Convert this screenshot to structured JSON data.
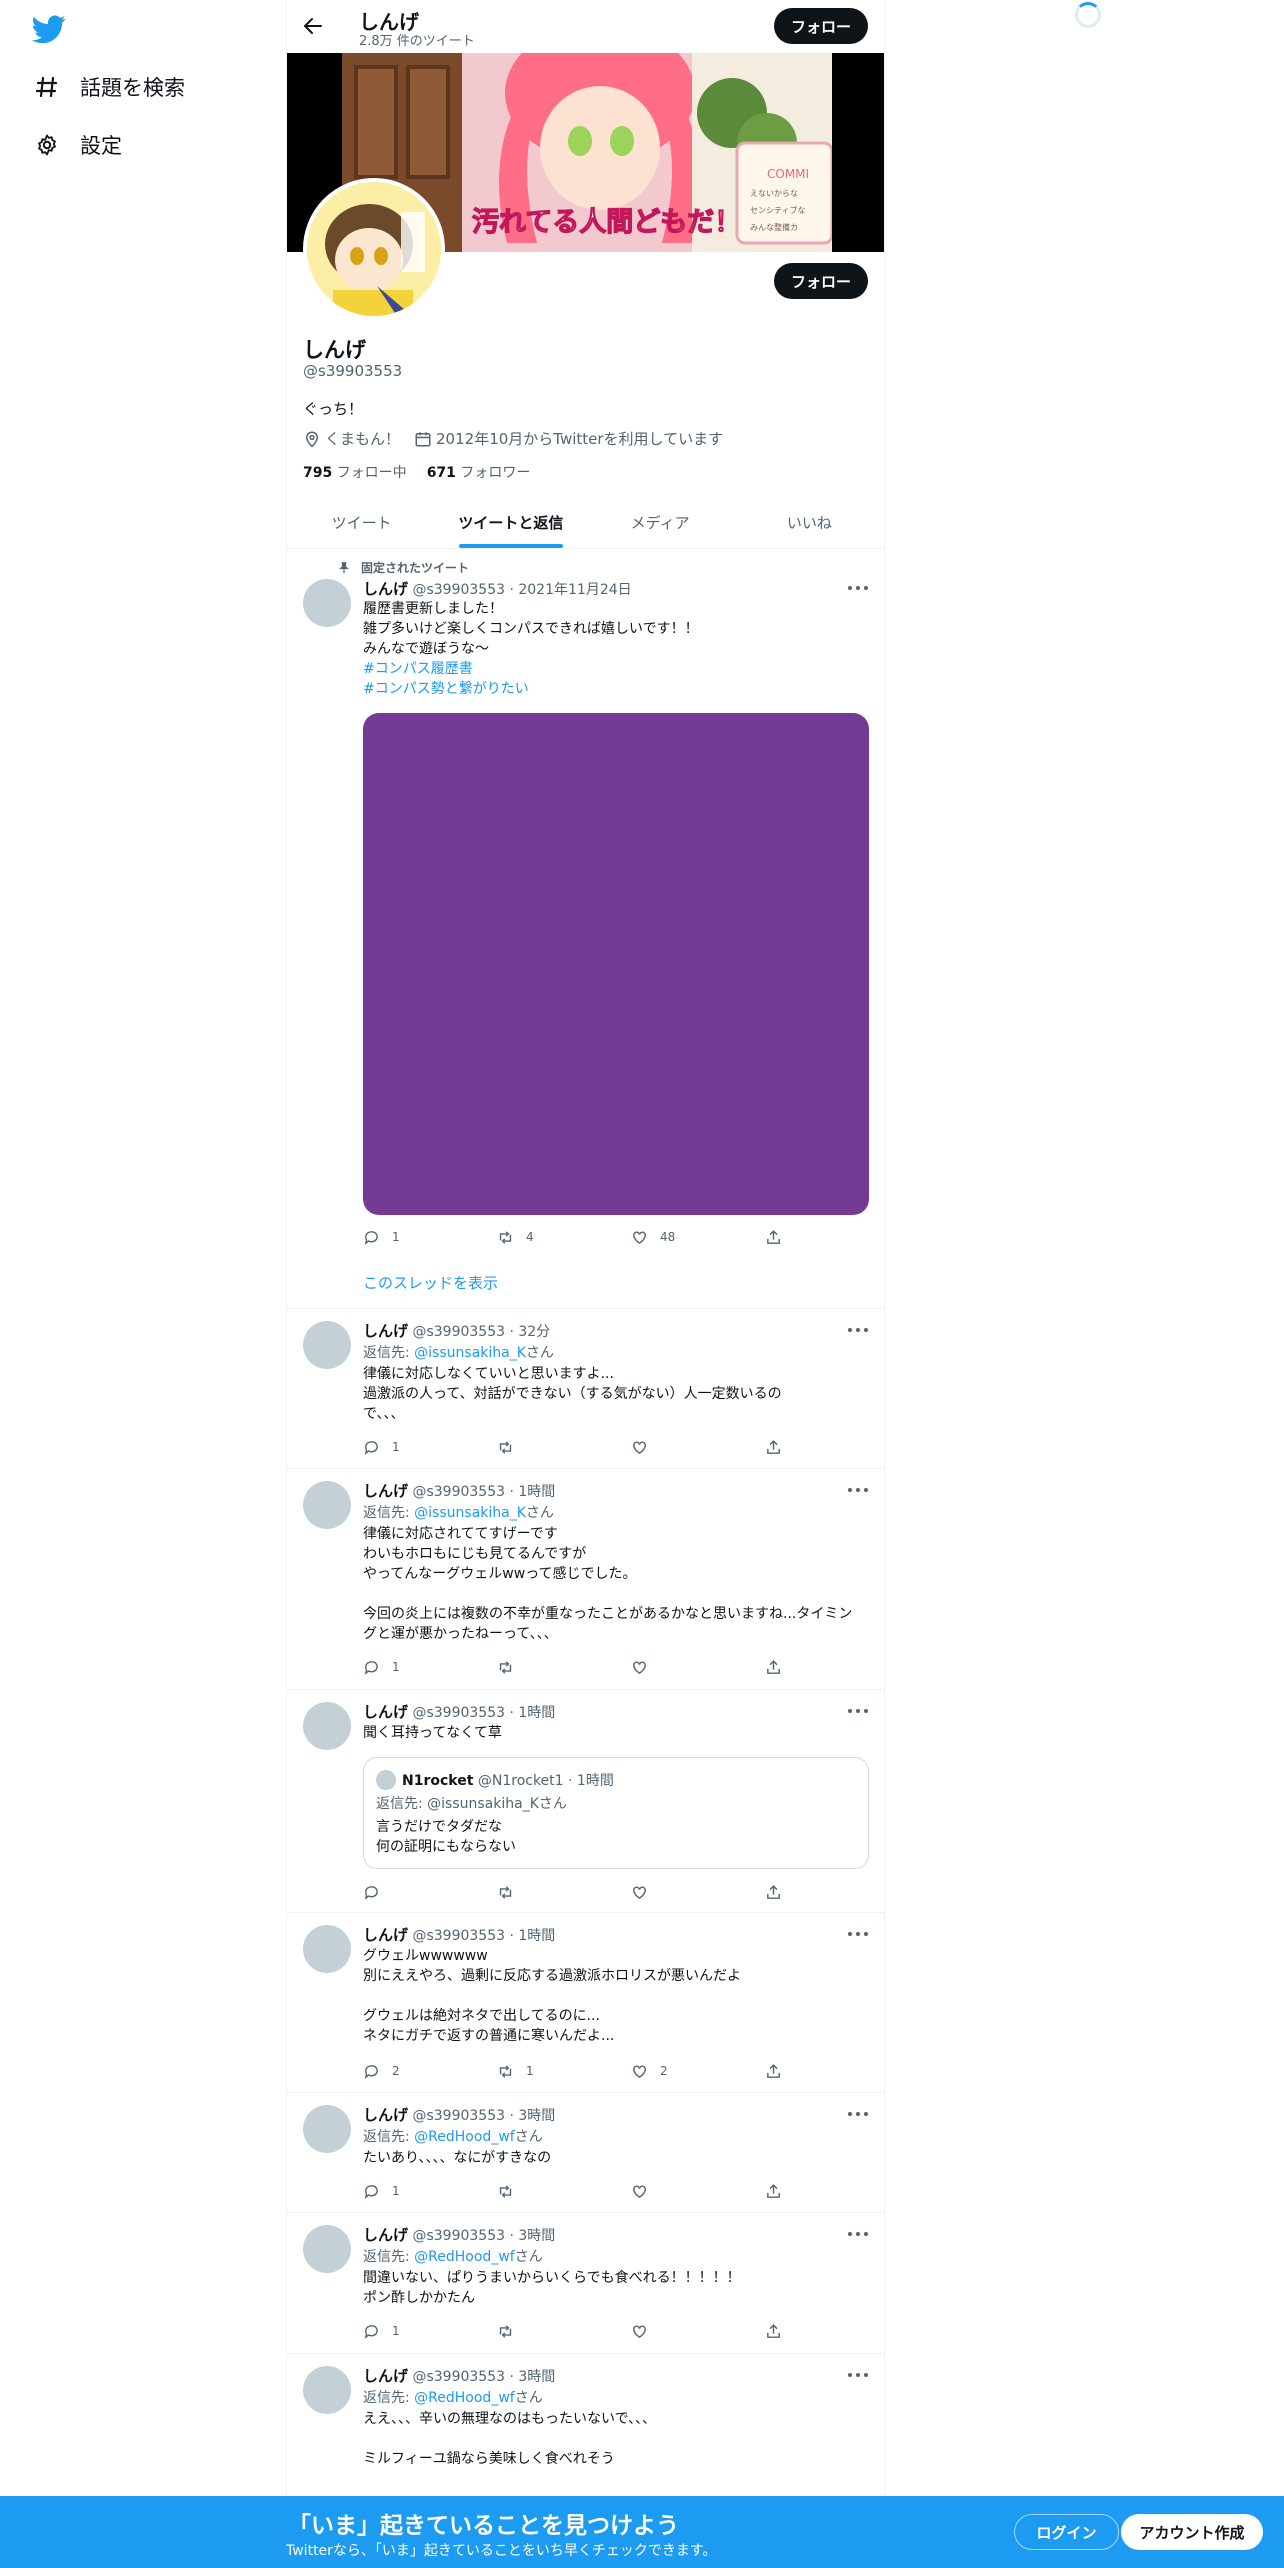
{
  "nav": {
    "explore_label": "話題を検索",
    "settings_label": "設定"
  },
  "header": {
    "name": "しんげ",
    "tweet_count": "2.8万 件のツイート",
    "follow_label": "フォロー"
  },
  "banner": {
    "caption": "汚れてる人間どもだ！",
    "art_text_1": "COMMI",
    "art_text_2": "えないからな",
    "art_text_3": "センシティブな",
    "art_text_4": "みんな整備カ"
  },
  "profile": {
    "name": "しんげ",
    "handle": "@s39903553",
    "bio": "ぐっち！",
    "location": "くまもん！",
    "joined": "2012年10月からTwitterを利用しています",
    "following_count": "795",
    "following_label": "フォロー中",
    "followers_count": "671",
    "followers_label": "フォロワー",
    "follow_label": "フォロー"
  },
  "tabs": [
    {
      "label": "ツイート"
    },
    {
      "label": "ツイートと返信"
    },
    {
      "label": "メディア"
    },
    {
      "label": "いいね"
    }
  ],
  "tweets": [
    {
      "pinned_label": "固定されたツイート",
      "name": "しんげ",
      "meta": "@s39903553 · 2021年11月24日",
      "body": "履歴書更新しました！\n雑プ多いけど楽しくコンパスできれば嬉しいです！！\nみんなで遊ぼうな〜",
      "hashtag_1": "#コンパス履歴書",
      "hashtag_2": "#コンパス勢と繋がりたい",
      "replies": "1",
      "retweets": "4",
      "likes": "48",
      "thread_link": "このスレッドを表示"
    },
    {
      "name": "しんげ",
      "meta": "@s39903553 · 32分",
      "reply_prefix": "返信先: ",
      "reply_to": "@issunsakiha_K",
      "reply_suffix": "さん",
      "body": "律儀に対応しなくていいと思いますよ...\n過激派の人って、対話ができない（する気がない）人一定数いるので、、、",
      "replies": "1",
      "retweets": "",
      "likes": ""
    },
    {
      "name": "しんげ",
      "meta": "@s39903553 · 1時間",
      "reply_prefix": "返信先: ",
      "reply_to": "@issunsakiha_K",
      "reply_suffix": "さん",
      "body": "律儀に対応されててすげーです\nわいもホロもにじも見てるんですが\nやってんなーグウェルwwって感じでした。\n\n今回の炎上には複数の不幸が重なったことがあるかなと思いますね...タイミングと運が悪かったねーって、、、",
      "replies": "1",
      "retweets": "",
      "likes": ""
    },
    {
      "name": "しんげ",
      "meta": "@s39903553 · 1時間",
      "body": "聞く耳持ってなくて草",
      "quote_name": "N1rocket",
      "quote_meta": "@N1rocket1 · 1時間",
      "quote_reply": "返信先: @issunsakiha_Kさん",
      "quote_body": "言うだけでタダだな\n何の証明にもならない",
      "replies": "",
      "retweets": "",
      "likes": ""
    },
    {
      "name": "しんげ",
      "meta": "@s39903553 · 1時間",
      "body": "グウェルwwwwww\n別にええやろ、過剰に反応する過激派ホロリスが悪いんだよ\n\nグウェルは絶対ネタで出してるのに...\nネタにガチで返すの普通に寒いんだよ...",
      "replies": "2",
      "retweets": "1",
      "likes": "2"
    },
    {
      "name": "しんげ",
      "meta": "@s39903553 · 3時間",
      "reply_prefix": "返信先: ",
      "reply_to": "@RedHood_wf",
      "reply_suffix": "さん",
      "body": "たいあり、、、、なにがすきなの",
      "replies": "1",
      "retweets": "",
      "likes": ""
    },
    {
      "name": "しんげ",
      "meta": "@s39903553 · 3時間",
      "reply_prefix": "返信先: ",
      "reply_to": "@RedHood_wf",
      "reply_suffix": "さん",
      "body": "間違いない、ぱりうまいからいくらでも食べれる！！！！！\nポン酢しかかたん",
      "replies": "1",
      "retweets": "",
      "likes": ""
    },
    {
      "name": "しんげ",
      "meta": "@s39903553 · 3時間",
      "reply_prefix": "返信先: ",
      "reply_to": "@RedHood_wf",
      "reply_suffix": "さん",
      "body": "ええ、、、辛いの無理なのはもったいないで、、、\n\nミルフィーユ鍋なら美味しく食べれそう"
    }
  ],
  "bottom_banner": {
    "title": "「いま」起きていることを見つけよう",
    "subtitle": "Twitterなら、「いま」起きていることをいち早くチェックできます。",
    "login_label": "ログイン",
    "signup_label": "アカウント作成"
  },
  "colors": {
    "accent": "#1d9bf0",
    "media_placeholder": "#753a94",
    "text": "#0f1419",
    "muted": "#536471"
  },
  "icons": [
    "twitter-logo-icon",
    "hash-icon",
    "gear-icon",
    "back-arrow-icon",
    "location-icon",
    "calendar-icon",
    "pin-icon",
    "reply-icon",
    "retweet-icon",
    "like-icon",
    "share-icon",
    "more-icon"
  ]
}
